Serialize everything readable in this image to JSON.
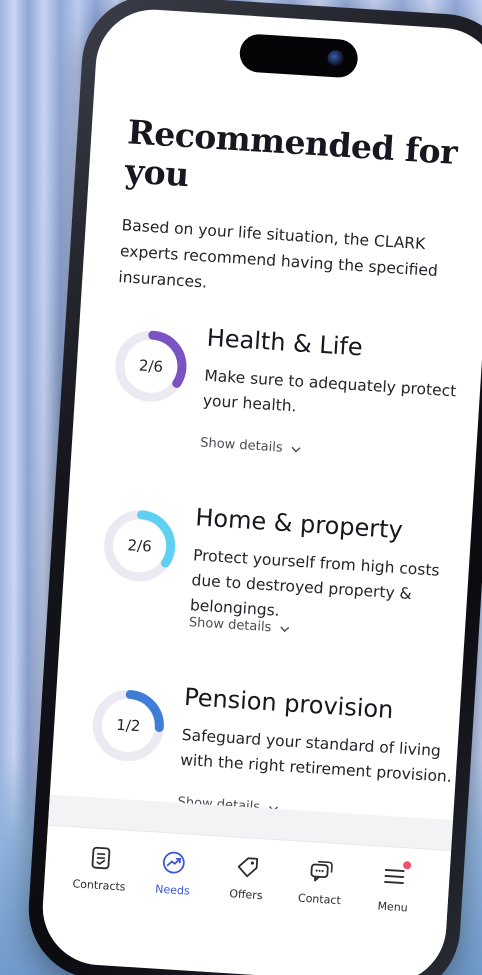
{
  "page": {
    "title": "Recommended for you",
    "subtitle": "Based on your life situation, the CLARK experts recommend having the specified insurances."
  },
  "needs": [
    {
      "title": "Health & Life",
      "description": "Make sure to adequately protect your health.",
      "progress_label": "2/6",
      "progress_fraction": 0.333,
      "color": "#7b54c4",
      "details_label": "Show details"
    },
    {
      "title": "Home & property",
      "description": "Protect yourself from high costs due to destroyed property & belongings.",
      "progress_label": "2/6",
      "progress_fraction": 0.333,
      "color": "#5fd0ef",
      "details_label": "Show details"
    },
    {
      "title": "Pension provision",
      "description": "Safeguard your standard of living with the right retirement provision.",
      "progress_label": "1/2",
      "progress_fraction": 0.25,
      "color": "#3f7ed8",
      "details_label": "Show details"
    }
  ],
  "tabbar": {
    "items": [
      {
        "label": "Contracts",
        "icon": "contracts-icon",
        "active": false
      },
      {
        "label": "Needs",
        "icon": "needs-icon",
        "active": true
      },
      {
        "label": "Offers",
        "icon": "tag-icon",
        "active": false
      },
      {
        "label": "Contact",
        "icon": "chat-icon",
        "active": false
      },
      {
        "label": "Menu",
        "icon": "menu-icon",
        "active": false
      }
    ],
    "active_color": "#3a56d4",
    "notification_color": "#f0506a"
  },
  "ring_track_color": "#ebe9f2"
}
